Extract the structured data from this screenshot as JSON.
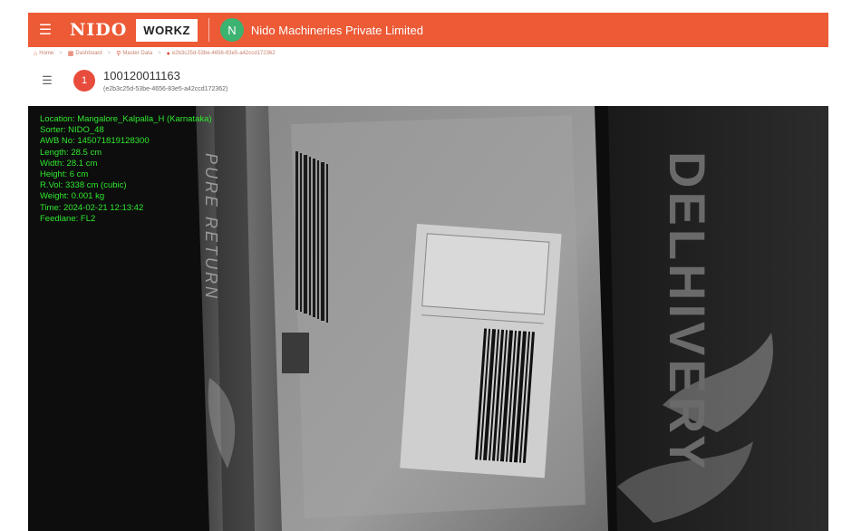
{
  "topbar": {
    "brand": "NIDO",
    "product": "WORKZ",
    "org_initial": "N",
    "org_name": "Nido Machineries Private Limited",
    "accent": "#ec5a36"
  },
  "breadcrumb": {
    "items": [
      "Home",
      "Dashboard",
      "Master Data",
      "e2b3c25d-53be-4656-83e5-a42ccd172362"
    ]
  },
  "header": {
    "avatar_initial": "1",
    "title": "100120011163",
    "subtitle": "(e2b3c25d-53be-4656-83e5-a42ccd172362)"
  },
  "scan": {
    "overlay_lines": [
      "Location: Mangalore_Kalpalla_H (Karnataka)",
      "Sorter: NIDO_48",
      "AWB No: 145071819128300",
      "Length: 28.5 cm",
      "Width: 28.1 cm",
      "Height: 6 cm",
      "R.Vol: 3338 cm (cubic)",
      "Weight: 0.001 kg",
      "Time: 2024-02-21 12:13:42",
      "Feedlane: FL2"
    ],
    "overlay_color": "#2ee82e",
    "package_text": {
      "left_vertical": "PURE RETURN",
      "right_vertical": "DELHIVERY"
    }
  }
}
